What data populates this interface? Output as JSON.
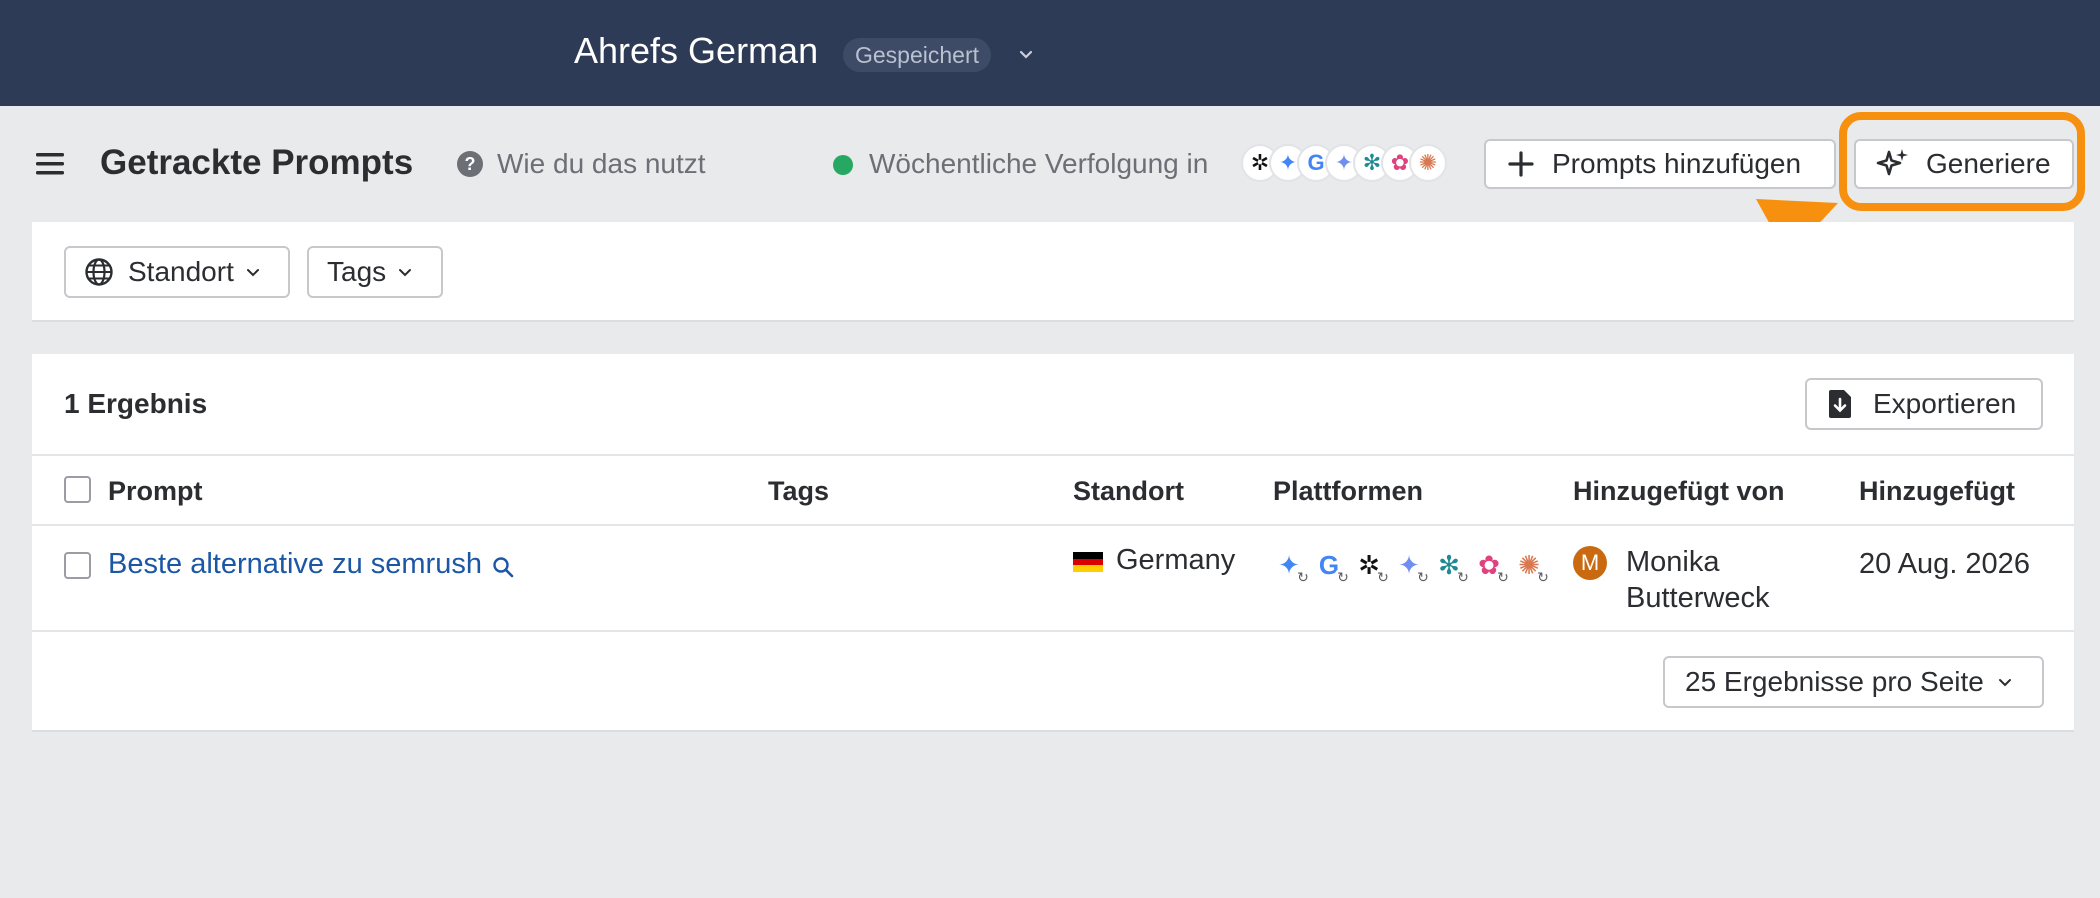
{
  "topbar": {
    "project_title": "Ahrefs German",
    "saved_badge": "Gespeichert"
  },
  "header": {
    "page_title": "Getrackte Prompts",
    "help_link": "Wie du das nutzt",
    "tracking_status": "Wöchentliche Verfolgung in",
    "status_color": "#27a862",
    "tracking_platforms": [
      "chatgpt-icon",
      "gemini-icon",
      "google-icon",
      "gemini-alt-icon",
      "perplexity-icon",
      "copilot-icon",
      "claude-icon"
    ],
    "add_prompts_label": "Prompts hinzufügen",
    "generate_label": "Generiere",
    "highlight_color": "#f7900f"
  },
  "filters": {
    "location_label": "Standort",
    "tags_label": "Tags"
  },
  "results": {
    "count_label": "1 Ergebnis",
    "export_label": "Exportieren",
    "columns": [
      "Prompt",
      "Tags",
      "Standort",
      "Plattformen",
      "Hinzugefügt von",
      "Hinzugefügt"
    ],
    "rows": [
      {
        "prompt": "Beste alternative zu semrush",
        "tags": "",
        "location": "Germany",
        "platforms": [
          "gemini-icon",
          "google-icon",
          "chatgpt-icon",
          "gemini-alt-icon",
          "perplexity-icon",
          "copilot-icon",
          "claude-icon"
        ],
        "added_by_initial": "M",
        "added_by": "Monika Butterweck",
        "added_date": "20 Aug. 2026"
      }
    ],
    "per_page_label": "25 Ergebnisse pro Seite"
  }
}
